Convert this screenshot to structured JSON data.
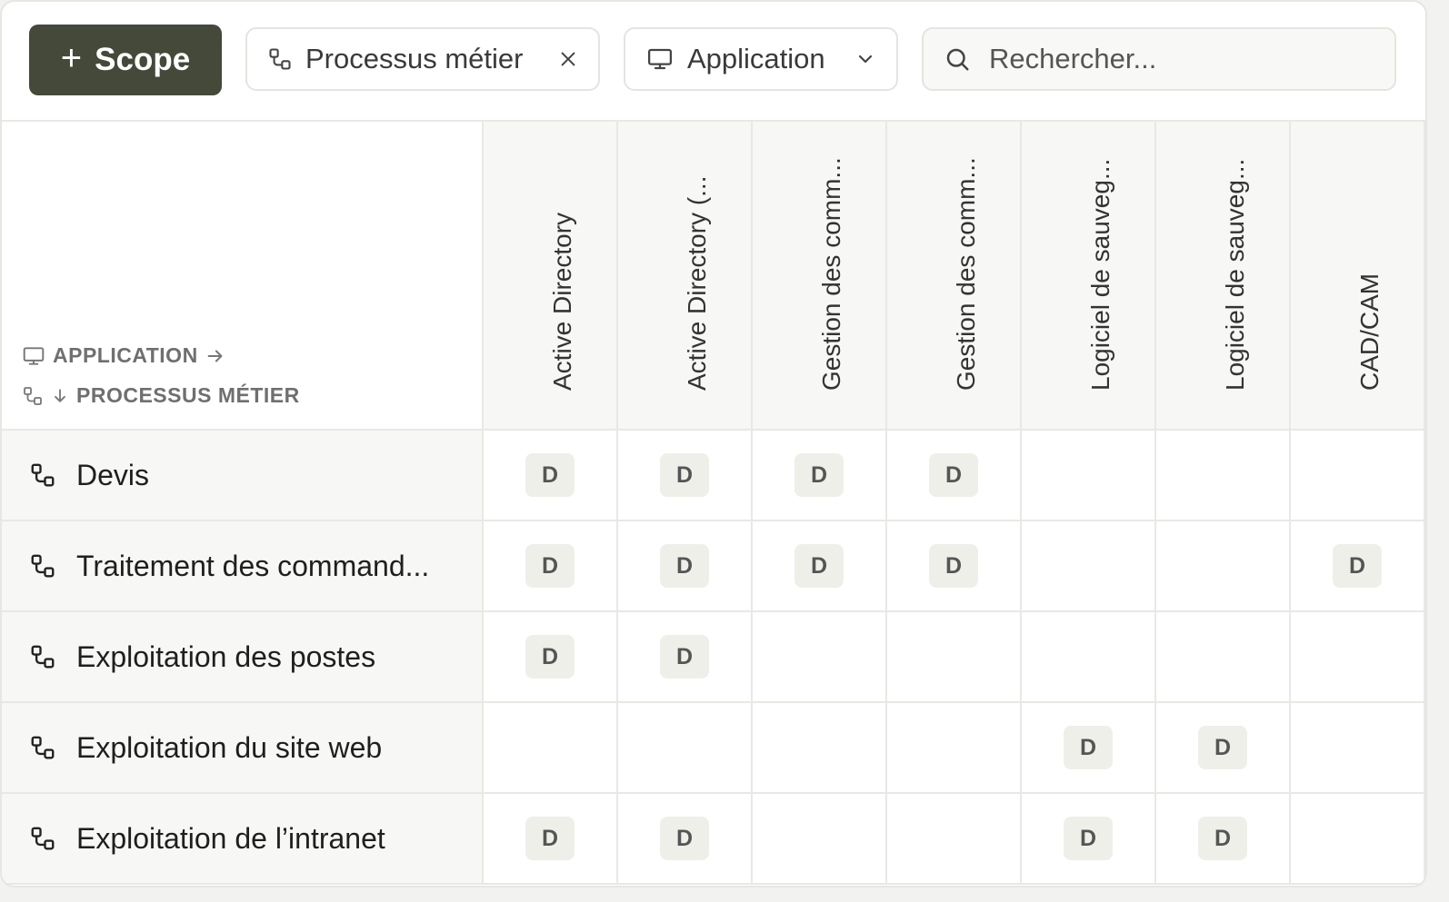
{
  "toolbar": {
    "scope_label": "Scope",
    "process_filter_label": "Processus métier",
    "application_filter_label": "Application",
    "search_placeholder": "Rechercher..."
  },
  "matrix": {
    "axis_columns_label": "APPLICATION",
    "axis_rows_label": "PROCESSUS MÉTIER",
    "columns": [
      "Active Directory",
      "Active Directory (...",
      "Gestion des comm...",
      "Gestion des comm...",
      "Logiciel de sauveg...",
      "Logiciel de sauveg...",
      "CAD/CAM"
    ],
    "badge_label": "D",
    "rows": [
      {
        "label": "Devis",
        "cells": [
          true,
          true,
          true,
          true,
          false,
          false,
          false
        ]
      },
      {
        "label": "Traitement des command...",
        "cells": [
          true,
          true,
          true,
          true,
          false,
          false,
          true
        ]
      },
      {
        "label": "Exploitation des postes",
        "cells": [
          true,
          true,
          false,
          false,
          false,
          false,
          false
        ]
      },
      {
        "label": "Exploitation du site web",
        "cells": [
          false,
          false,
          false,
          false,
          true,
          true,
          false
        ]
      },
      {
        "label": "Exploitation de l’intranet",
        "cells": [
          true,
          true,
          false,
          false,
          true,
          true,
          false
        ]
      }
    ]
  },
  "colors": {
    "primary": "#44493a",
    "badge_bg": "#efefea",
    "header_bg": "#f7f7f5"
  }
}
